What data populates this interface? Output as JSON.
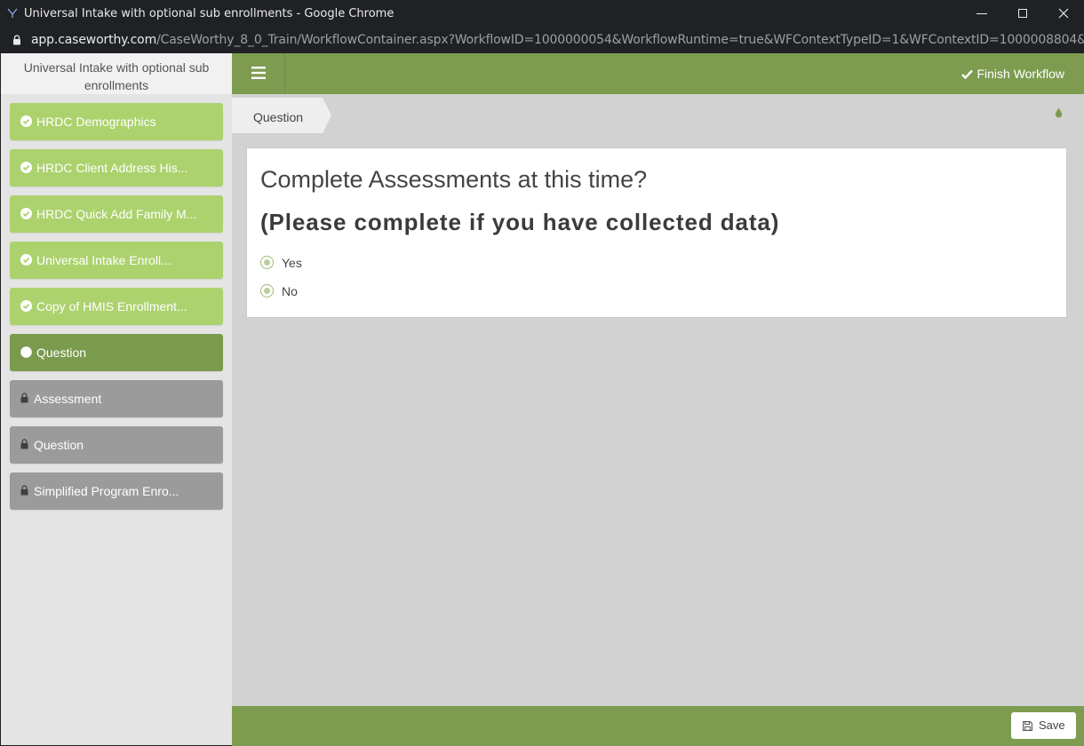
{
  "browser": {
    "window_title": "Universal Intake with optional sub enrollments - Google Chrome",
    "url_host": "app.caseworthy.com",
    "url_path": "/CaseWorthy_8_0_Train/WorkflowContainer.aspx?WorkflowID=1000000054&WorkflowRuntime=true&WFContextTypeID=1&WFContextID=1000008804&"
  },
  "sidebar": {
    "title": "Universal Intake with optional sub enrollments",
    "steps": [
      {
        "label": "HRDC Demographics",
        "state": "complete",
        "icon": "check-circle-icon"
      },
      {
        "label": "HRDC Client Address His...",
        "state": "complete",
        "icon": "check-circle-icon"
      },
      {
        "label": "HRDC Quick Add Family M...",
        "state": "complete",
        "icon": "check-circle-icon"
      },
      {
        "label": "Universal Intake Enroll...",
        "state": "complete",
        "icon": "check-circle-icon"
      },
      {
        "label": "Copy of HMIS Enrollment...",
        "state": "complete",
        "icon": "check-circle-icon"
      },
      {
        "label": "Question",
        "state": "active",
        "icon": "circle-icon"
      },
      {
        "label": "Assessment",
        "state": "locked",
        "icon": "lock-icon"
      },
      {
        "label": "Question",
        "state": "locked",
        "icon": "lock-icon"
      },
      {
        "label": "Simplified Program Enro...",
        "state": "locked",
        "icon": "lock-icon"
      }
    ]
  },
  "topbar": {
    "finish_label": "Finish Workflow"
  },
  "breadcrumb": {
    "label": "Question"
  },
  "form": {
    "question": "Complete Assessments at this time?",
    "instruction": "(Please complete if you have collected data)",
    "options": [
      "Yes",
      "No"
    ]
  },
  "footer": {
    "save_label": "Save"
  },
  "colors": {
    "brand_green": "#7d9c50",
    "step_complete": "#acd26e",
    "step_active": "#7a9a4d",
    "step_locked": "#9b9b9b"
  }
}
